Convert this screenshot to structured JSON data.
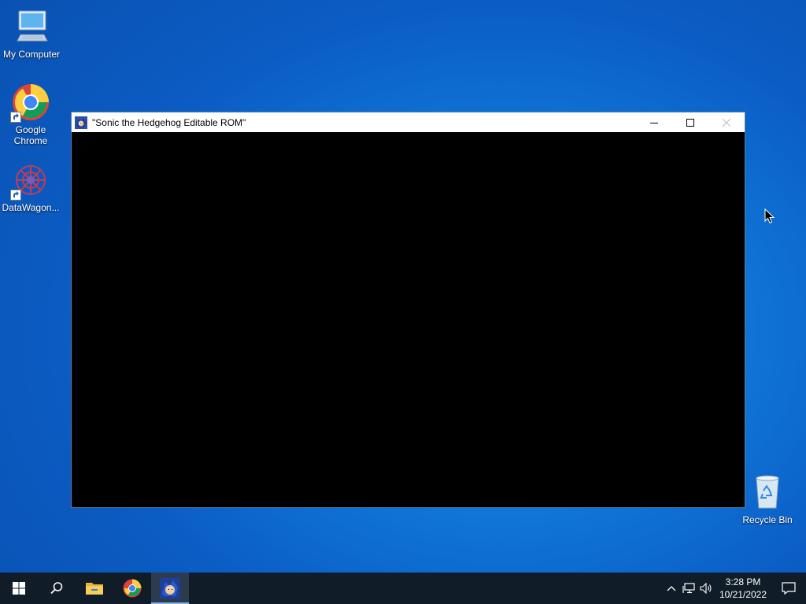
{
  "desktop": {
    "icons": [
      {
        "label": "My Computer",
        "icon": "computer-icon"
      },
      {
        "label": "Google Chrome",
        "icon": "chrome-icon"
      },
      {
        "label": "DataWagon...",
        "icon": "datawagon-icon"
      },
      {
        "label": "Recycle Bin",
        "icon": "recycle-bin-icon"
      }
    ]
  },
  "window": {
    "title": "\"Sonic the Hedgehog Editable ROM\"",
    "app_icon": "sonic-icon",
    "content_color": "#000000"
  },
  "taskbar": {
    "items": [
      {
        "name": "start",
        "icon": "windows-logo-icon"
      },
      {
        "name": "search",
        "icon": "search-icon"
      },
      {
        "name": "file-explorer",
        "icon": "folder-icon"
      },
      {
        "name": "chrome",
        "icon": "chrome-icon"
      },
      {
        "name": "sonic",
        "icon": "sonic-icon",
        "active": true
      }
    ],
    "tray": {
      "time": "3:28 PM",
      "date": "10/21/2022"
    }
  },
  "colors": {
    "taskbar": "#101c28",
    "desktop_accent": "#0f74d6",
    "titlebar": "#ffffff"
  }
}
